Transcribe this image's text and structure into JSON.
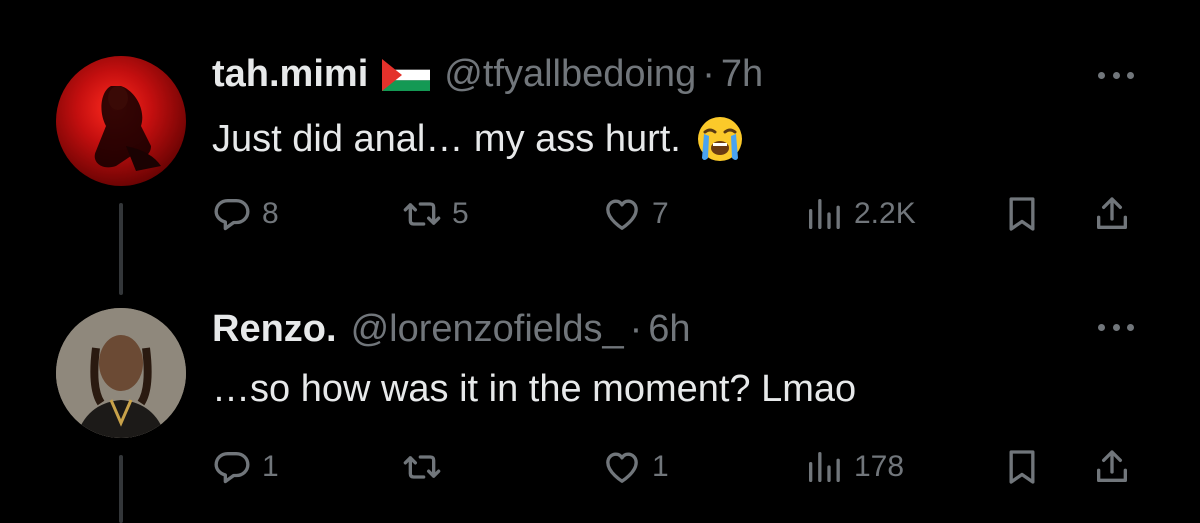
{
  "tweets": [
    {
      "name": "tah.mimi",
      "handle": "@tfyallbedoing",
      "separator": "·",
      "time": "7h",
      "text": "Just did anal… my ass hurt.",
      "replies": "8",
      "retweets": "5",
      "likes": "7",
      "views": "2.2K",
      "name_flag_icon": "palestine-flag-icon",
      "text_emoji_icon": "loudly-crying-face-icon"
    },
    {
      "name": "Renzo.",
      "handle": "@lorenzofields_",
      "separator": "·",
      "time": "6h",
      "text": "…so how was it in the moment? Lmao",
      "replies": "1",
      "retweets": "",
      "likes": "1",
      "views": "178"
    }
  ],
  "colors": {
    "background": "#000000",
    "primary_text": "#e7e9ea",
    "secondary_text": "#71767b",
    "thread_line": "#333639"
  },
  "icons": {
    "more": "more-icon",
    "reply": "reply-icon",
    "retweet": "retweet-icon",
    "like": "heart-icon",
    "views": "views-icon",
    "bookmark": "bookmark-icon",
    "share": "share-icon"
  }
}
